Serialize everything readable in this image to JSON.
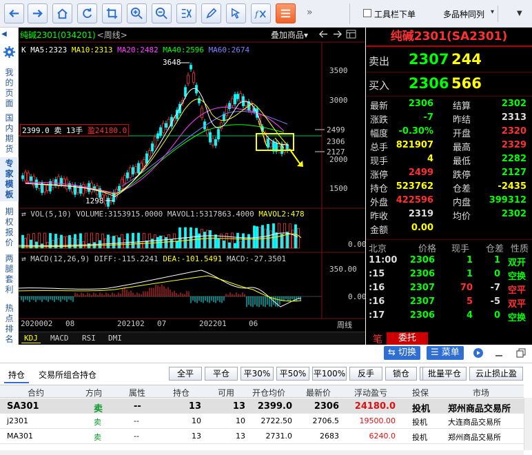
{
  "toolbar": {
    "icons": [
      "back-arrow-icon",
      "forward-arrow-icon",
      "home-icon",
      "refresh-icon",
      "crop-icon",
      "zoom-in-icon",
      "zoom-out-icon",
      "indicator-icon",
      "draw-pen-icon",
      "cursor-select-icon",
      "formula-fx-icon",
      "list-menu-icon"
    ],
    "more": "»",
    "toolbar_checkbox_label": "工具栏下单",
    "multi_label": "多品种同列",
    "caret": "▾",
    "down": "▼"
  },
  "sidebar": {
    "items": [
      "我的页面",
      "国内期货",
      "专家模板",
      "期权报价",
      "两腿套利",
      "热点排名"
    ],
    "active_index": 2
  },
  "chart": {
    "symbol": "纯碱2301(034201)",
    "period": "<周线>",
    "overlay": "叠加商品▾",
    "ma": [
      {
        "label": "K  MA5:2323",
        "color": "#ffffff"
      },
      {
        "label": "MA10:2313",
        "color": "#ffff00"
      },
      {
        "label": "MA20:2482",
        "color": "#ff40ff"
      },
      {
        "label": "MA40:2596",
        "color": "#00ff00"
      },
      {
        "label": "MA60:2674",
        "color": "#8080ff"
      }
    ],
    "high_label": "3648",
    "low_label": "1298",
    "y_ticks": [
      "3500",
      "3000",
      "2499",
      "2306",
      "2127",
      "2000",
      "1500"
    ],
    "position_label_prefix": "2399.0  卖  13手 ",
    "position_label_pnl": "盈24180.0",
    "vol_line": "VOL(5,10) VOLUME:3153915.0000 MAVOL1:5317863.4000",
    "vol_line2": "MAVOL2:478",
    "vol_axis": "0.00",
    "macd_line_a": "MACD(12,26,9) DIFF:-115.2241",
    "macd_line_b": "DEA:-101.5491",
    "macd_line_c": "MACD:-27.3501",
    "macd_axis_top": "350.00",
    "macd_axis_zero": "0.00",
    "x_ticks": [
      "2020002",
      "08",
      "202102",
      "07",
      "202201",
      "06"
    ],
    "x_period": "周线",
    "indicator_tabs": [
      "KDJ",
      "MACD",
      "RSI",
      "DMI"
    ]
  },
  "quote": {
    "title": "纯碱2301(SA2301)",
    "sell": {
      "label": "卖出",
      "price": "2307",
      "vol": "244"
    },
    "buy": {
      "label": "买入",
      "price": "2306",
      "vol": "566"
    },
    "rows": [
      {
        "l": "最新",
        "v": "2306",
        "vc": "g",
        "l2": "结算",
        "v2": "2302",
        "v2c": "g"
      },
      {
        "l": "涨跌",
        "v": "-7",
        "vc": "g",
        "l2": "昨结",
        "v2": "2313",
        "v2c": "w"
      },
      {
        "l": "幅度",
        "v": "-0.30%",
        "vc": "g",
        "l2": "开盘",
        "v2": "2320",
        "v2c": "r"
      },
      {
        "l": "总手",
        "v": "821907",
        "vc": "y",
        "l2": "最高",
        "v2": "2329",
        "v2c": "r"
      },
      {
        "l": "现手",
        "v": "4",
        "vc": "y",
        "l2": "最低",
        "v2": "2282",
        "v2c": "g"
      },
      {
        "l": "涨停",
        "v": "2499",
        "vc": "r",
        "l2": "跌停",
        "v2": "2127",
        "v2c": "g"
      },
      {
        "l": "持仓",
        "v": "523762",
        "vc": "y",
        "l2": "仓差",
        "v2": "-2435",
        "v2c": "y"
      },
      {
        "l": "外盘",
        "v": "422596",
        "vc": "r",
        "l2": "内盘",
        "v2": "399312",
        "v2c": "g"
      },
      {
        "l": "昨收",
        "v": "2319",
        "vc": "w",
        "l2": "均价",
        "v2": "2302",
        "v2c": "g"
      },
      {
        "l": "金额",
        "v": "0.00",
        "vc": "y",
        "l2": "",
        "v2": "",
        "v2c": "w"
      }
    ],
    "tick_header": [
      "北京",
      "价格",
      "现手",
      "仓差",
      "性质"
    ],
    "ticks": [
      {
        "t": "11:00",
        "p": "2306",
        "pc": "g",
        "v": "1",
        "vc": "g",
        "d": "1",
        "dc": "g",
        "n": "双开",
        "nc": "g"
      },
      {
        "t": ":15",
        "p": "2306",
        "pc": "g",
        "v": "1",
        "vc": "g",
        "d": "0",
        "dc": "g",
        "n": "空换",
        "nc": "g"
      },
      {
        "t": ":16",
        "p": "2307",
        "pc": "g",
        "v": "70",
        "vc": "r",
        "d": "-7",
        "dc": "w",
        "n": "空平",
        "nc": "r"
      },
      {
        "t": ":16",
        "p": "2307",
        "pc": "g",
        "v": "5",
        "vc": "r",
        "d": "-5",
        "dc": "w",
        "n": "双平",
        "nc": "r"
      },
      {
        "t": ":17",
        "p": "2306",
        "pc": "g",
        "v": "4",
        "vc": "g",
        "d": "0",
        "dc": "g",
        "n": "空换",
        "nc": "g"
      }
    ],
    "order_pen": "笔",
    "order_tab": "委托"
  },
  "buttons": {
    "switch": "⇆ 切换",
    "menu": "☰ 菜单"
  },
  "bottom": {
    "tabs": [
      "持仓",
      "交易所组合持仓"
    ],
    "actions": [
      "全平",
      "平仓",
      "平30%",
      "平50%",
      "平100%",
      "反手",
      "锁仓",
      "投保",
      "批量平仓",
      "云止损止盈"
    ],
    "columns": [
      "合约",
      "方向",
      "属性",
      "持仓",
      "可用",
      "开仓均价",
      "最新价",
      "浮动盈亏",
      "投保",
      "市场"
    ],
    "rows": [
      {
        "contract": "SA301",
        "dir": "卖",
        "attr": "--",
        "pos": "13",
        "avail": "13",
        "avg": "2399.0",
        "last": "2306",
        "pnl": "24180.0",
        "hedge": "投机",
        "market": "郑州商品交易所"
      },
      {
        "contract": "j2301",
        "dir": "卖",
        "attr": "--",
        "pos": "10",
        "avail": "10",
        "avg": "2722.50",
        "last": "2706.5",
        "pnl": "19500.00",
        "hedge": "投机",
        "market": "大连商品交易所"
      },
      {
        "contract": "MA301",
        "dir": "卖",
        "attr": "--",
        "pos": "13",
        "avail": "13",
        "avg": "2731.0",
        "last": "2683",
        "pnl": "6240.0",
        "hedge": "投机",
        "market": "郑州商品交易所"
      }
    ]
  },
  "colors": {
    "up": "#ff3030",
    "down": "#00ff00",
    "accent": "#2f6fd4"
  }
}
